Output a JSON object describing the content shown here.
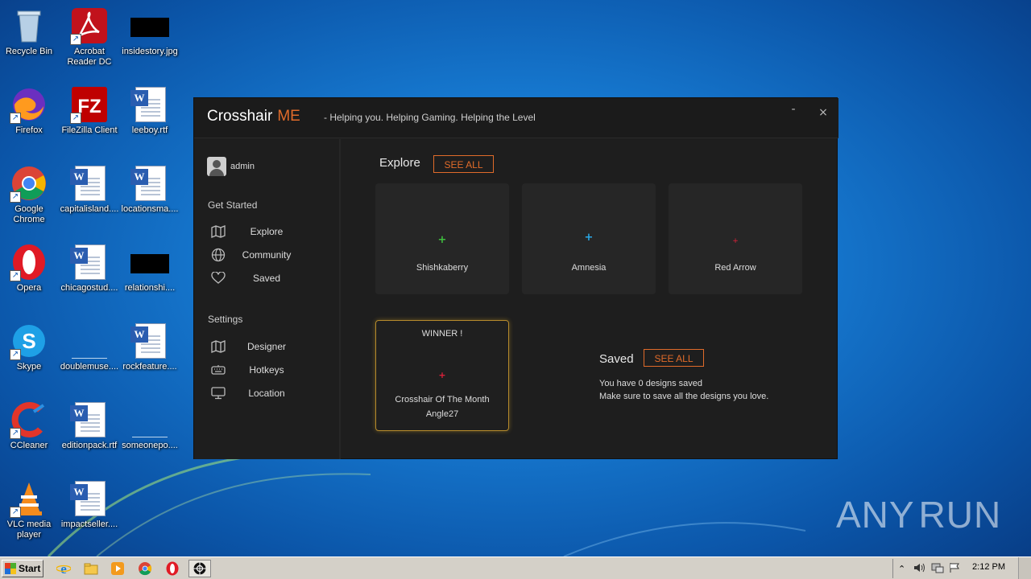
{
  "desktop": {
    "icons": [
      {
        "label": "Recycle Bin",
        "icon": "recycle-bin-icon"
      },
      {
        "label": "Acrobat Reader DC",
        "icon": "acrobat-icon"
      },
      {
        "label": "insidestory.jpg",
        "icon": "image-file-icon"
      },
      {
        "label": "Firefox",
        "icon": "firefox-icon"
      },
      {
        "label": "FileZilla Client",
        "icon": "filezilla-icon"
      },
      {
        "label": "leeboy.rtf",
        "icon": "word-document-icon"
      },
      {
        "label": "Google Chrome",
        "icon": "chrome-icon"
      },
      {
        "label": "capitalisland....",
        "icon": "word-document-icon"
      },
      {
        "label": "locationsma....",
        "icon": "word-document-icon"
      },
      {
        "label": "Opera",
        "icon": "opera-icon"
      },
      {
        "label": "chicagostud....",
        "icon": "word-document-icon"
      },
      {
        "label": "relationshi....",
        "icon": "image-file-icon"
      },
      {
        "label": "Skype",
        "icon": "skype-icon"
      },
      {
        "label": "doublemuse....",
        "icon": "blank-file-icon"
      },
      {
        "label": "rockfeature....",
        "icon": "word-document-icon"
      },
      {
        "label": "CCleaner",
        "icon": "ccleaner-icon"
      },
      {
        "label": "editionpack.rtf",
        "icon": "word-document-icon"
      },
      {
        "label": "someonepo....",
        "icon": "blank-file-icon"
      },
      {
        "label": "VLC media player",
        "icon": "vlc-icon"
      },
      {
        "label": "impactseller....",
        "icon": "word-document-icon"
      }
    ]
  },
  "app": {
    "brand": "Crosshair",
    "brand_suffix": "ME",
    "tagline": "- Helping you. Helping Gaming. Helping the Level",
    "minimize": "-",
    "close": "×",
    "user": {
      "name": "admin"
    },
    "sidebar": {
      "get_started_title": "Get Started",
      "get_started": [
        {
          "label": "Explore",
          "icon": "map-icon"
        },
        {
          "label": "Community",
          "icon": "globe-icon"
        },
        {
          "label": "Saved",
          "icon": "heart-icon"
        }
      ],
      "settings_title": "Settings",
      "settings": [
        {
          "label": "Designer",
          "icon": "map-icon"
        },
        {
          "label": "Hotkeys",
          "icon": "keyboard-icon"
        },
        {
          "label": "Location",
          "icon": "monitor-icon"
        }
      ]
    },
    "explore": {
      "title": "Explore",
      "see_all": "SEE ALL",
      "cards": [
        {
          "name": "Shishkaberry",
          "symbol": "+",
          "color": "#3fbf3f"
        },
        {
          "name": "Amnesia",
          "symbol": "+",
          "color": "#29a9e8"
        },
        {
          "name": "Red Arrow",
          "symbol": "+",
          "color": "#e0203a"
        }
      ]
    },
    "winner": {
      "title": "WINNER !",
      "symbol": "+",
      "color": "#e0203a",
      "line1": "Crosshair Of The Month",
      "line2": "Angle27"
    },
    "saved": {
      "title": "Saved",
      "see_all": "SEE ALL",
      "line1": "You have 0 designs saved",
      "line2": "Make sure to save all the designs you love."
    },
    "accent": "#e06b2a"
  },
  "watermark": "ANY RUN",
  "taskbar": {
    "start_label": "Start",
    "pinned": [
      "ie-icon",
      "explorer-icon",
      "media-player-icon",
      "chrome-icon",
      "opera-icon",
      "crosshair-app-icon"
    ],
    "clock": "2:12 PM"
  }
}
